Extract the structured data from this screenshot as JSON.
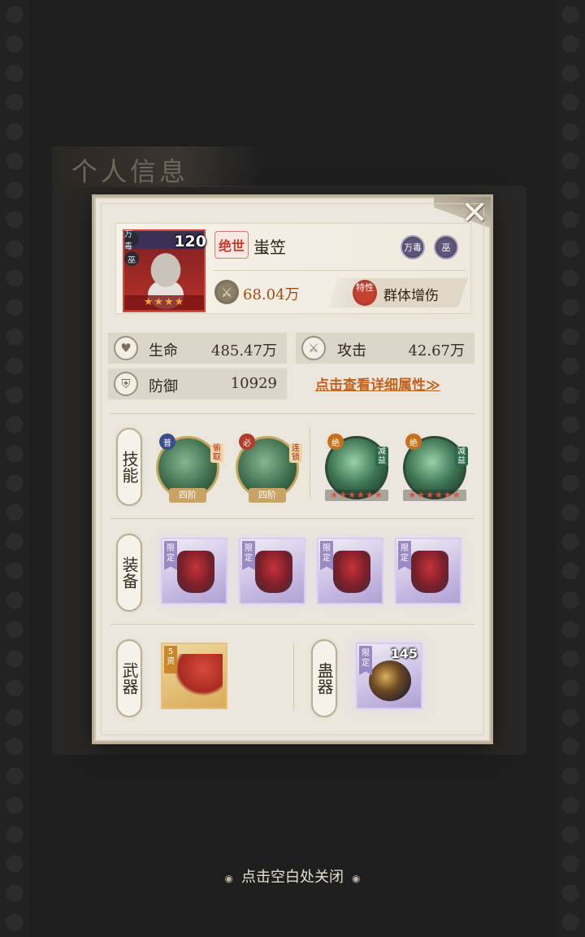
{
  "background": {
    "panel_title": "个人信息"
  },
  "hero": {
    "level": "120",
    "rarity_badge": "绝世",
    "name": "蚩笠",
    "stars": "★★★★",
    "portrait_stamps": [
      "万毒",
      "巫"
    ],
    "faction_icons": [
      "万毒",
      "巫"
    ],
    "power": "68.04万",
    "trait_badge": "特性",
    "trait": "群体增伤"
  },
  "stats": {
    "hp_label": "生命",
    "hp_value": "485.47万",
    "atk_label": "攻击",
    "atk_value": "42.67万",
    "def_label": "防御",
    "def_value": "10929",
    "detail_link": "点击查看详细属性≫"
  },
  "sections": {
    "skills": "技能",
    "equipment": "装备",
    "weapon": "武器",
    "gu": "蛊器"
  },
  "skills": [
    {
      "tag": "普",
      "side": "偷取",
      "rank": "四阶"
    },
    {
      "tag": "必",
      "side": "连锁",
      "rank": "四阶"
    },
    {
      "tag": "绝",
      "side": "减益",
      "stars": "★★★★★★"
    },
    {
      "tag": "绝",
      "side": "减益",
      "stars": "★★★★★★"
    }
  ],
  "equipment": [
    {
      "limited": "限定",
      "icon": "boots-icon"
    },
    {
      "limited": "限定",
      "icon": "armor-icon"
    },
    {
      "limited": "限定",
      "icon": "gauntlet-icon"
    },
    {
      "limited": "限定",
      "icon": "helmet-icon"
    }
  ],
  "weapon": {
    "grade": "5资",
    "icon": "umbrella-icon"
  },
  "gu": {
    "limited": "限定",
    "count": "145",
    "icon": "gourd-icon"
  },
  "close_hint": "点击空白处关闭"
}
